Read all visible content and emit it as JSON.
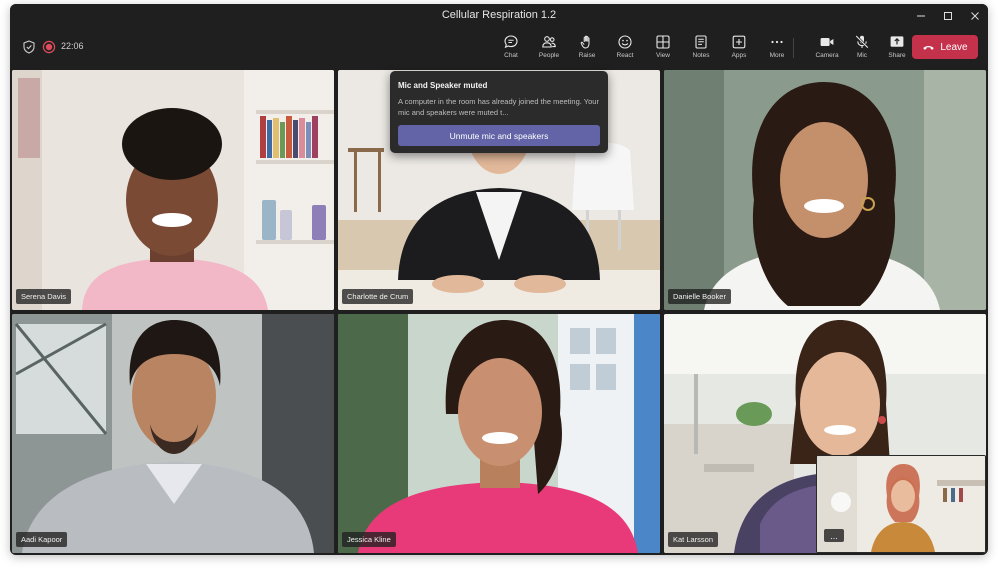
{
  "window": {
    "title": "Cellular Respiration 1.2"
  },
  "toolbar": {
    "timer": "22:06",
    "buttons": [
      {
        "label": "Chat",
        "icon": "chat-icon"
      },
      {
        "label": "People",
        "icon": "people-icon"
      },
      {
        "label": "Raise",
        "icon": "raise-hand-icon"
      },
      {
        "label": "React",
        "icon": "react-icon"
      },
      {
        "label": "View",
        "icon": "view-icon"
      },
      {
        "label": "Notes",
        "icon": "notes-icon"
      },
      {
        "label": "Apps",
        "icon": "apps-icon"
      },
      {
        "label": "More",
        "icon": "more-icon"
      },
      {
        "label": "Camera",
        "icon": "camera-icon"
      },
      {
        "label": "Mic",
        "icon": "mic-off-icon"
      },
      {
        "label": "Share",
        "icon": "share-icon"
      }
    ],
    "leave_label": "Leave",
    "leave_color": "#c4314b"
  },
  "popup": {
    "title": "Mic and Speaker muted",
    "body": "A computer in the room has already joined the meeting. Your mic and speakers were muted t...",
    "button_label": "Unmute mic and speakers",
    "accent": "#6264a7"
  },
  "participants": [
    {
      "name": "Serena Davis"
    },
    {
      "name": "Charlotte de Crum"
    },
    {
      "name": "Danielle Booker"
    },
    {
      "name": "Aadi Kapoor"
    },
    {
      "name": "Jessica Kline"
    },
    {
      "name": "Kat Larsson"
    }
  ],
  "pip": {
    "more_label": "..."
  }
}
